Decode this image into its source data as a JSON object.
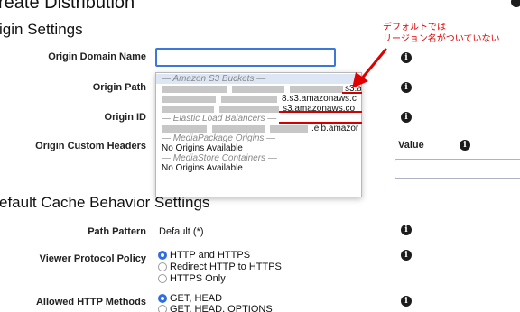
{
  "page_title": "reate Distribution",
  "origin_settings": {
    "heading": "igin Settings",
    "fields": {
      "domain_label": "Origin Domain Name",
      "path_label": "Origin Path",
      "id_label": "Origin ID",
      "headers_label": "Origin Custom Headers",
      "headers_value_label": "Value"
    }
  },
  "dropdown": {
    "groups": {
      "s3": "— Amazon S3 Buckets —",
      "elb": "— Elastic Load Balancers —",
      "mediapackage": "— MediaPackage Origins —",
      "mediastore": "— MediaStore Containers —"
    },
    "items": {
      "s3_1_suffix": "s3.a",
      "s3_2_suffix": "8.s3.amazonaws.c",
      "s3_3_suffix": "s3.amazonaws.co",
      "elb_1_suffix": ".elb.amazor",
      "mediapackage_empty": "No Origins Available",
      "mediastore_empty": "No Origins Available"
    }
  },
  "annotation": {
    "line1": "デフォルトでは",
    "line2": "リージョン名がついていない",
    "color": "#e00000"
  },
  "cache_behavior": {
    "heading": "efault Cache Behavior Settings",
    "path_pattern_label": "Path Pattern",
    "path_pattern_value": "Default (*)",
    "viewer_protocol_label": "Viewer Protocol Policy",
    "viewer_protocol_options": [
      "HTTP and HTTPS",
      "Redirect HTTP to HTTPS",
      "HTTPS Only"
    ],
    "viewer_protocol_selected": "HTTP and HTTPS",
    "allowed_methods_label": "Allowed HTTP Methods",
    "allowed_methods_options": [
      "GET, HEAD",
      "GET, HEAD, OPTIONS"
    ],
    "allowed_methods_selected": "GET, HEAD"
  },
  "icons": {
    "info": "info-icon",
    "info_glyph": "i",
    "top_right": "help-icon"
  },
  "colors": {
    "accent": "#3b78d8",
    "radio_selected": "#2f6ee0",
    "annotation": "#e00000",
    "highlight_row": "#dce6f5"
  }
}
